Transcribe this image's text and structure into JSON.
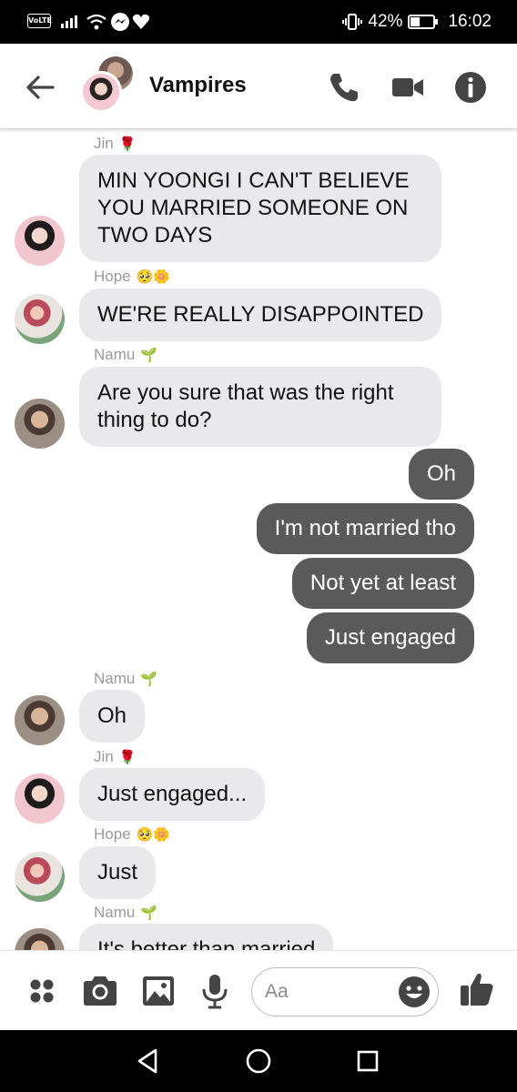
{
  "status_bar": {
    "volte": "VoLTE",
    "battery_percent": "42%",
    "battery_level": 0.42,
    "time": "16:02"
  },
  "header": {
    "title": "Vampires",
    "icons": [
      "back-arrow-icon",
      "phone-icon",
      "video-camera-icon",
      "info-icon"
    ]
  },
  "messages": [
    {
      "type": "in",
      "sender": "Jin",
      "sender_emoji": "🌹",
      "text": "MIN YOONGI I CAN'T BELIEVE YOU MARRIED SOMEONE ON TWO DAYS"
    },
    {
      "type": "in",
      "sender": "Hope",
      "sender_emoji": "🥺🌼",
      "text": "WE'RE REALLY DISAPPOINTED"
    },
    {
      "type": "in",
      "sender": "Namu",
      "sender_emoji": "🌱",
      "text": "Are you sure that was the right thing to do?"
    },
    {
      "type": "out",
      "text": "Oh"
    },
    {
      "type": "out",
      "text": "I'm not married tho"
    },
    {
      "type": "out",
      "text": "Not yet at least"
    },
    {
      "type": "out",
      "text": "Just engaged"
    },
    {
      "type": "in",
      "sender": "Namu",
      "sender_emoji": "🌱",
      "text": "Oh"
    },
    {
      "type": "in",
      "sender": "Jin",
      "sender_emoji": "🌹",
      "text": "Just engaged..."
    },
    {
      "type": "in",
      "sender": "Hope",
      "sender_emoji": "🥺🌼",
      "text": "Just"
    },
    {
      "type": "in",
      "sender": "Namu",
      "sender_emoji": "🌱",
      "text": "It's better than married"
    }
  ],
  "composer": {
    "placeholder": "Aa",
    "icons": [
      "menu-dots-icon",
      "camera-icon",
      "gallery-icon",
      "microphone-icon",
      "emoji-icon",
      "thumbs-up-icon"
    ]
  },
  "nav_bar": {
    "icons": [
      "back-triangle-icon",
      "home-circle-icon",
      "recents-square-icon"
    ]
  }
}
